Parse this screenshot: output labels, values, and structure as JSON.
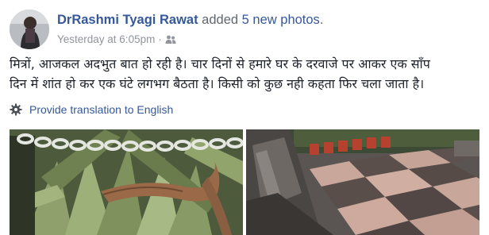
{
  "post": {
    "author": "DrRashmi Tyagi Rawat",
    "action_prefix": "added",
    "photos_link": "5 new photos",
    "action_suffix": ".",
    "timestamp": "Yesterday at 6:05pm",
    "separator": "·",
    "audience_icon": "friends-icon",
    "text_lines": [
      "मित्रों, आजकल अदभुत बात हो रही है। चार दिनों से हमारे घर के दरवाजे पर आकर एक साँप",
      "दिन में शांत हो कर एक घंटे लगभग बैठता है। किसी को कुछ नही कहता फिर चला जाता है।"
    ],
    "translation_link": "Provide translation to English",
    "translation_icon": "gear-icon"
  },
  "colors": {
    "link": "#365899",
    "meta": "#90949c",
    "text": "#1d2129"
  }
}
